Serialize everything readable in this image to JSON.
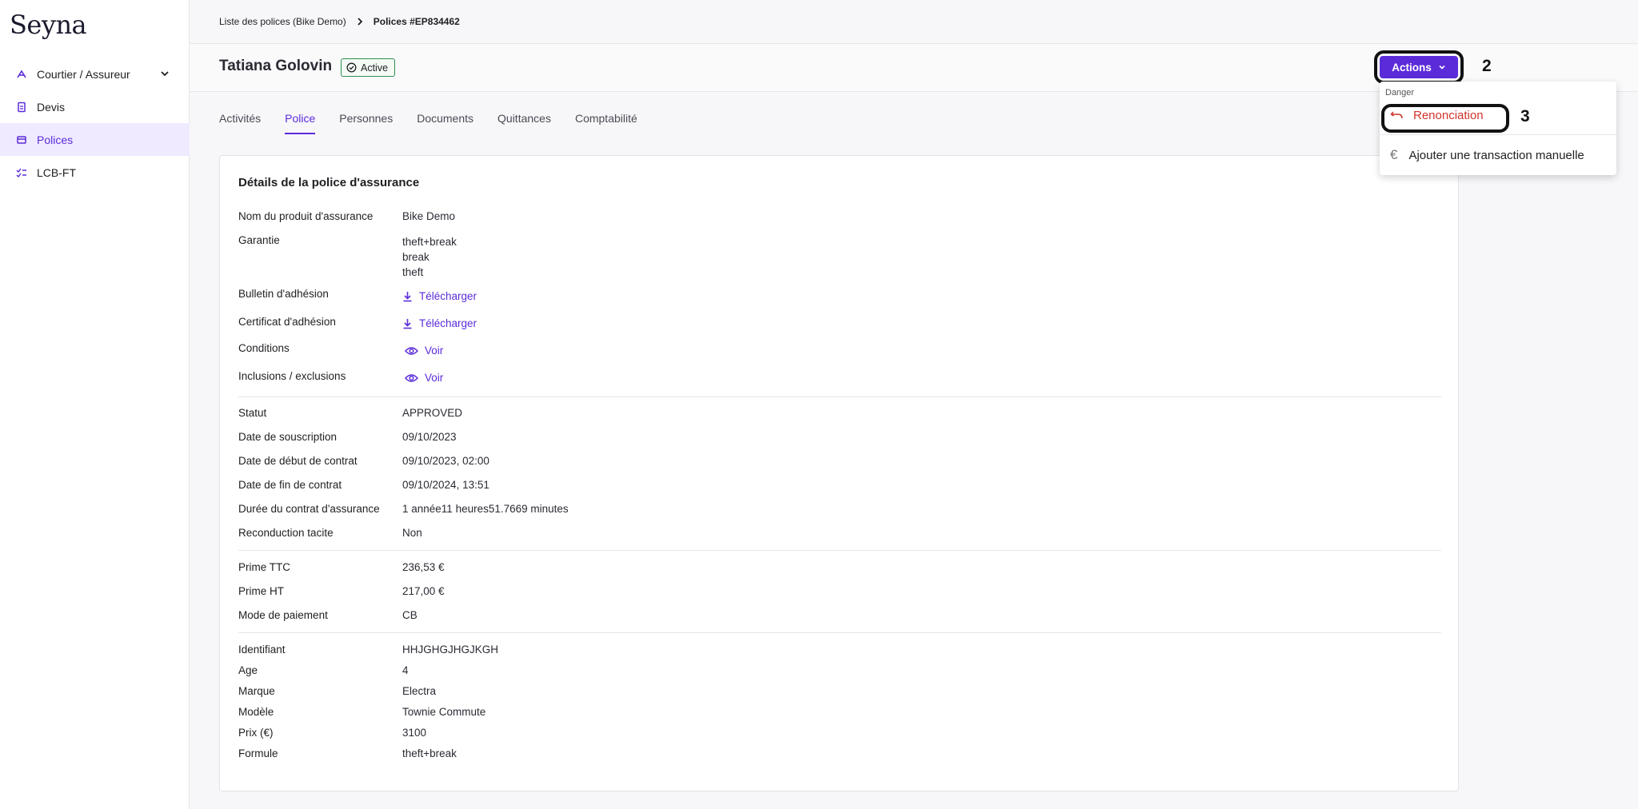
{
  "brand": "Seyna",
  "sidebar": {
    "items": [
      {
        "label": "Courtier / Assureur"
      },
      {
        "label": "Devis"
      },
      {
        "label": "Polices"
      },
      {
        "label": "LCB-FT"
      }
    ]
  },
  "breadcrumb": {
    "parent": "Liste des polices (Bike Demo)",
    "current": "Polices #EP834462"
  },
  "header": {
    "title": "Tatiana Golovin",
    "status": "Active",
    "actions_label": "Actions",
    "step_actions": "2"
  },
  "tabs": [
    "Activités",
    "Police",
    "Personnes",
    "Documents",
    "Quittances",
    "Comptabilité"
  ],
  "dropdown": {
    "section": "Danger",
    "item1": "Renonciation",
    "item2": "Ajouter une transaction manuelle",
    "step": "3",
    "euro_glyph": "€"
  },
  "details": {
    "title": "Détails de la police d'assurance",
    "product_label": "Nom du produit d'assurance",
    "product_value": "Bike Demo",
    "garantie_label": "Garantie",
    "garantie_values": [
      "theft+break",
      "break",
      "theft"
    ],
    "bulletin_label": "Bulletin d'adhésion",
    "certificat_label": "Certificat d'adhésion",
    "conditions_label": "Conditions",
    "inclusions_label": "Inclusions / exclusions",
    "download_label": "Télécharger",
    "view_label": "Voir",
    "statut_label": "Statut",
    "statut_value": "APPROVED",
    "souscription_label": "Date de souscription",
    "souscription_value": "09/10/2023",
    "debut_label": "Date de début de contrat",
    "debut_value": "09/10/2023, 02:00",
    "fin_label": "Date de fin de contrat",
    "fin_value": "09/10/2024, 13:51",
    "duree_label": "Durée du contrat d'assurance",
    "duree_value": "1 année11 heures51.7669 minutes",
    "reconduction_label": "Reconduction tacite",
    "reconduction_value": "Non",
    "prime_ttc_label": "Prime TTC",
    "prime_ttc_value": "236,53 €",
    "prime_ht_label": "Prime HT",
    "prime_ht_value": "217,00 €",
    "paiement_label": "Mode de paiement",
    "paiement_value": "CB",
    "identifiant_label": "Identifiant",
    "identifiant_value": "HHJGHGJHGJKGH",
    "age_label": "Age",
    "age_value": "4",
    "marque_label": "Marque",
    "marque_value": "Electra",
    "modele_label": "Modèle",
    "modele_value": "Townie Commute",
    "prix_label": "Prix (€)",
    "prix_value": "3100",
    "formule_label": "Formule",
    "formule_value": "theft+break"
  },
  "colors": {
    "accent": "#5b2bd9",
    "danger": "#d0342c",
    "success": "#2f8f4e"
  }
}
